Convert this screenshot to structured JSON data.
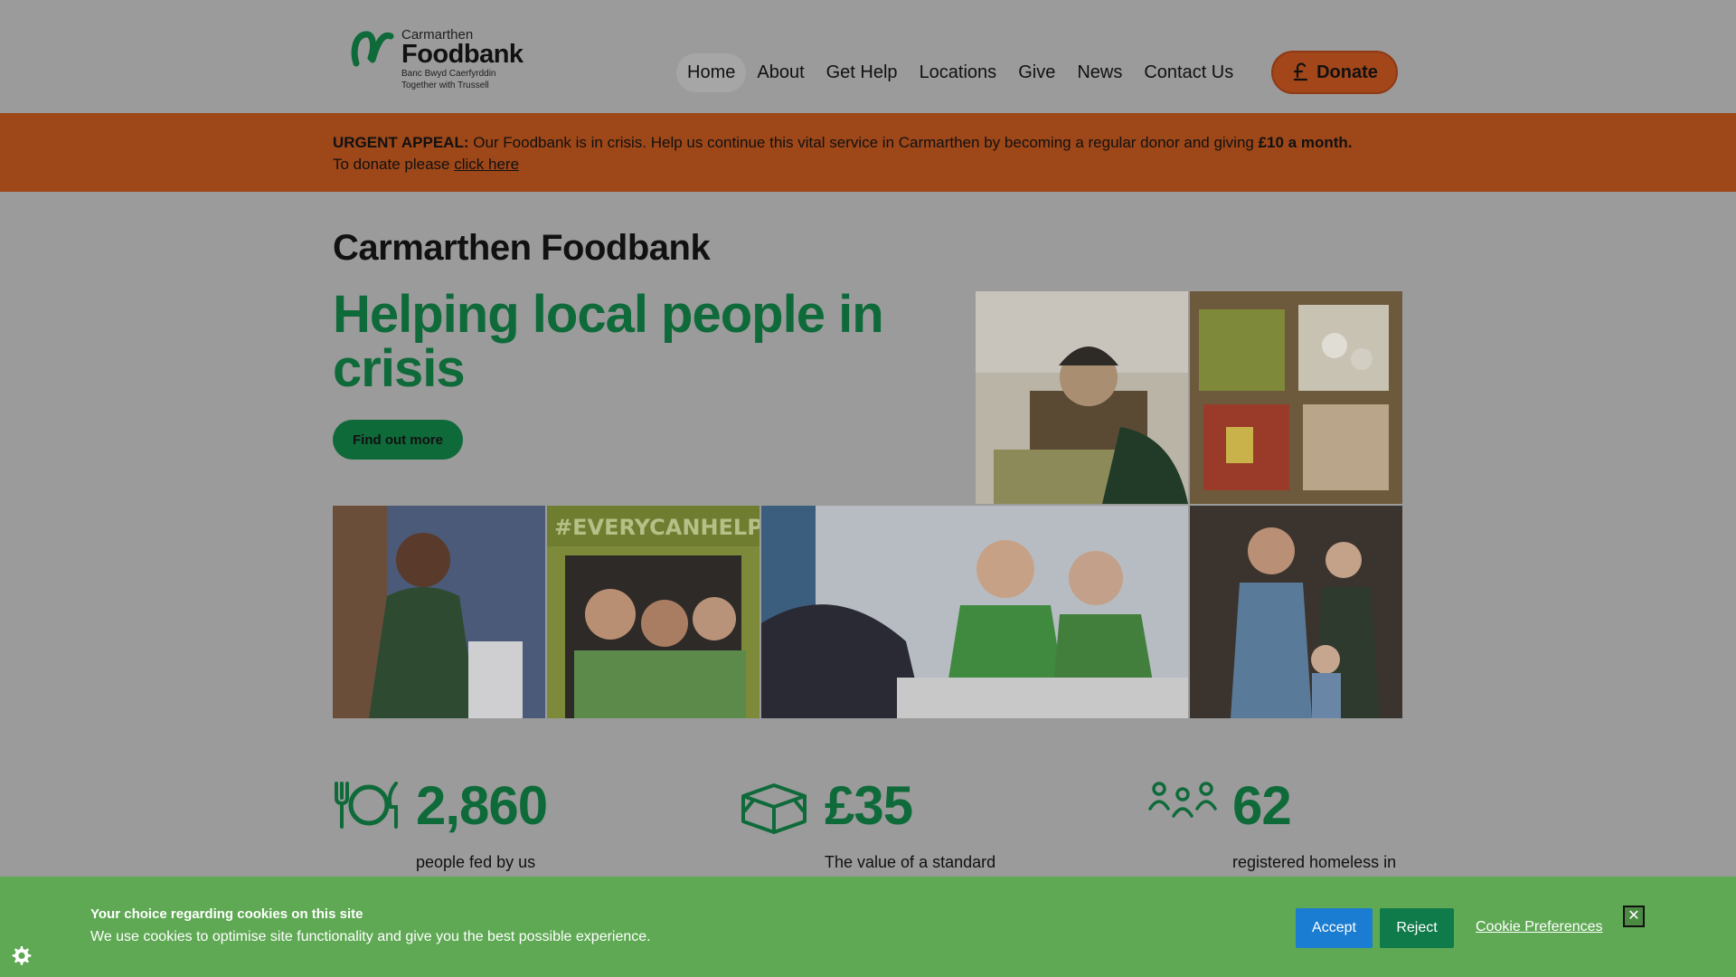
{
  "header": {
    "logo": {
      "line1": "Carmarthen",
      "line2": "Foodbank",
      "line3": "Banc Bwyd Caerfyrddin",
      "line4": "Together with Trussell"
    },
    "nav": [
      {
        "label": "Home",
        "active": true
      },
      {
        "label": "About"
      },
      {
        "label": "Get Help"
      },
      {
        "label": "Locations"
      },
      {
        "label": "Give"
      },
      {
        "label": "News"
      },
      {
        "label": "Contact Us"
      }
    ],
    "donate_label": "Donate"
  },
  "appeal": {
    "lead": "URGENT APPEAL:",
    "text": " Our Foodbank is in crisis. Help us continue this vital service in Carmarthen by becoming a regular donor and giving ",
    "amount": "£10 a month.",
    "donate_prefix": "To donate please ",
    "link": "click here"
  },
  "hero": {
    "site_title": "Carmarthen Foodbank",
    "headline": "Helping local people in crisis",
    "cta": "Find out more"
  },
  "stats": [
    {
      "icon": "plate-cutlery-icon",
      "value": "2,860",
      "desc": "people fed by us"
    },
    {
      "icon": "box-icon",
      "value": "£35",
      "desc": "The value of a standard"
    },
    {
      "icon": "people-icon",
      "value": "62",
      "desc": "registered homeless in"
    }
  ],
  "cookie": {
    "title": "Your choice regarding cookies on this site",
    "text": "We use cookies to optimise site functionality and give you the best possible experience.",
    "accept": "Accept",
    "reject": "Reject",
    "preferences": "Cookie Preferences",
    "close": "✕"
  },
  "colors": {
    "brand_green": "#0f6a3a",
    "appeal_orange": "#9e4719",
    "cookie_green": "#5fa954",
    "accept_blue": "#1a7dd1"
  }
}
